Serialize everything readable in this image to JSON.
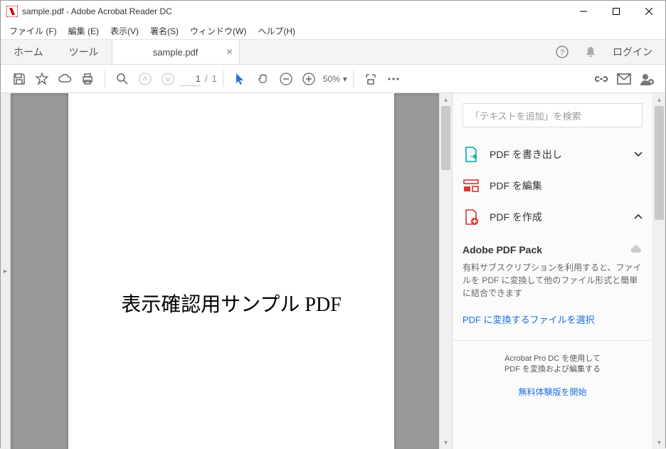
{
  "window": {
    "title": "sample.pdf - Adobe Acrobat Reader DC"
  },
  "menubar": {
    "items": [
      "ファイル (F)",
      "編集 (E)",
      "表示(V)",
      "署名(S)",
      "ウィンドウ(W)",
      "ヘルプ(H)"
    ]
  },
  "tabbar": {
    "home": "ホーム",
    "tools": "ツール",
    "doc_tab": "sample.pdf",
    "login": "ログイン"
  },
  "toolbar": {
    "page_current": "1",
    "page_sep": "/",
    "page_total": "1",
    "zoom": "50%"
  },
  "document": {
    "heading": "表示確認用サンプル PDF"
  },
  "sidepanel": {
    "search_placeholder": "「テキストを追加」を検索",
    "export_label": "PDF を書き出し",
    "edit_label": "PDF を編集",
    "create_label": "PDF を作成",
    "pack": {
      "title": "Adobe PDF Pack",
      "desc": "有料サブスクリプションを利用すると、ファイルを PDF に変換して他のファイル形式と簡単に結合できます",
      "link": "PDF に変換するファイルを選択"
    },
    "promo": {
      "line1": "Acrobat Pro DC を使用して",
      "line2": "PDF を変換および編集する",
      "trial": "無料体験版を開始"
    }
  }
}
